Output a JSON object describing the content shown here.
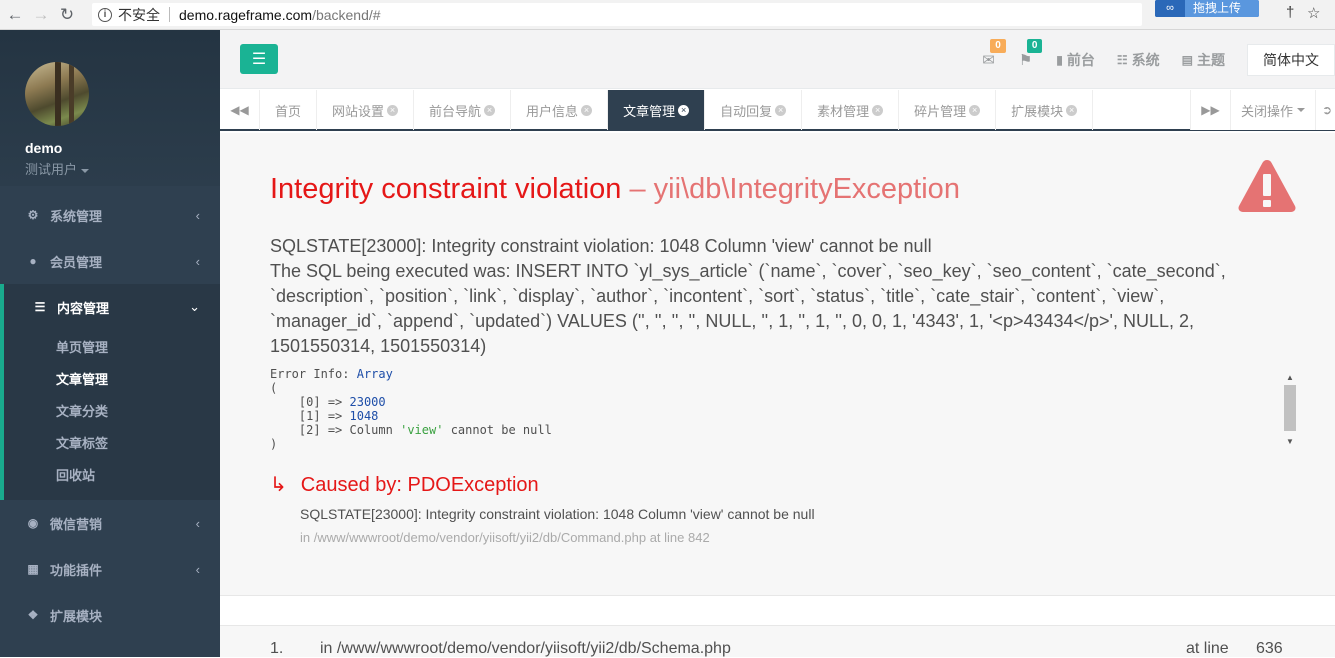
{
  "browser": {
    "insecure_label": "不安全",
    "url_host": "demo.rageframe.com",
    "url_path": "/backend/#",
    "extension_label": "拖拽上传"
  },
  "sidebar": {
    "user_name": "demo",
    "user_role": "测试用户",
    "menu": [
      {
        "label": "系统管理",
        "icon": "cogs-icon"
      },
      {
        "label": "会员管理",
        "icon": "user-icon"
      },
      {
        "label": "内容管理",
        "icon": "bars-icon"
      },
      {
        "label": "微信营销",
        "icon": "wechat-icon"
      },
      {
        "label": "功能插件",
        "icon": "windows-icon"
      },
      {
        "label": "扩展模块",
        "icon": "cubes-icon"
      }
    ],
    "submenu": [
      "单页管理",
      "文章管理",
      "文章分类",
      "文章标签",
      "回收站"
    ]
  },
  "topbar": {
    "mail_count": "0",
    "bell_count": "0",
    "frontend_label": "前台",
    "system_label": "系统",
    "theme_label": "主题",
    "language": "简体中文"
  },
  "tabs": {
    "items": [
      "首页",
      "网站设置",
      "前台导航",
      "用户信息",
      "文章管理",
      "自动回复",
      "素材管理",
      "碎片管理",
      "扩展模块"
    ],
    "close_ops_label": "关闭操作"
  },
  "error": {
    "title": "Integrity constraint violation",
    "dash": "–",
    "exception_class": "yii\\db\\IntegrityException",
    "message_line1": "SQLSTATE[23000]: Integrity constraint violation: 1048 Column 'view' cannot be null",
    "message_line2": "The SQL being executed was: INSERT INTO `yl_sys_article` (`name`, `cover`, `seo_key`, `seo_content`, `cate_second`, `description`, `position`, `link`, `display`, `author`, `incontent`, `sort`, `status`, `title`, `cate_stair`, `content`, `view`, `manager_id`, `append`, `updated`) VALUES ('', '', '', '', NULL, '', 1, '', 1, '', 0, 0, 1, '4343', 1, '<p>43434</p>', NULL, 2, 1501550314, 1501550314)",
    "info_label": "Error Info:",
    "info_type": "Array",
    "info_entries": [
      {
        "key": "[0]",
        "value": "23000"
      },
      {
        "key": "[1]",
        "value": "1048"
      },
      {
        "key": "[2]",
        "value_prefix": "Column",
        "value_str": "'view'",
        "value_suffix": "cannot be null"
      }
    ],
    "caused_label": "Caused by: PDOException",
    "caused_message": "SQLSTATE[23000]: Integrity constraint violation: 1048 Column 'view' cannot be null",
    "caused_location": "in /www/wwwroot/demo/vendor/yiisoft/yii2/db/Command.php at line 842"
  },
  "trace": {
    "num": "1.",
    "file": "in /www/wwwroot/demo/vendor/yiisoft/yii2/db/Schema.php",
    "at_label": "at line",
    "line": "636"
  },
  "colors": {
    "sidebar_bg": "#2f4050",
    "accent": "#1ab394",
    "error_red": "#e51717",
    "warn_icon": "#e57373"
  }
}
